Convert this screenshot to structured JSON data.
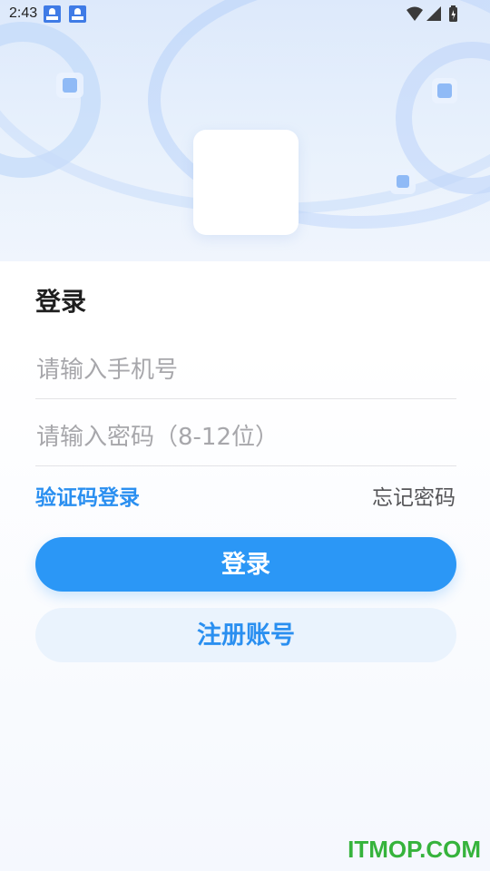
{
  "status_bar": {
    "time": "2:43"
  },
  "login": {
    "title": "登录",
    "phone_placeholder": "请输入手机号",
    "password_placeholder": "请输入密码（8-12位）",
    "sms_login_label": "验证码登录",
    "forgot_password_label": "忘记密码",
    "login_button_label": "登录",
    "register_button_label": "注册账号"
  },
  "watermark": "ITMOP.COM",
  "colors": {
    "primary": "#2b97f6",
    "link": "#2a8ff0",
    "secondary_button_bg": "#eaf3fd",
    "watermark": "#36b33c"
  },
  "icons": [
    "notification-app-icon",
    "notification-app-icon",
    "wifi-icon",
    "signal-icon",
    "battery-icon"
  ]
}
